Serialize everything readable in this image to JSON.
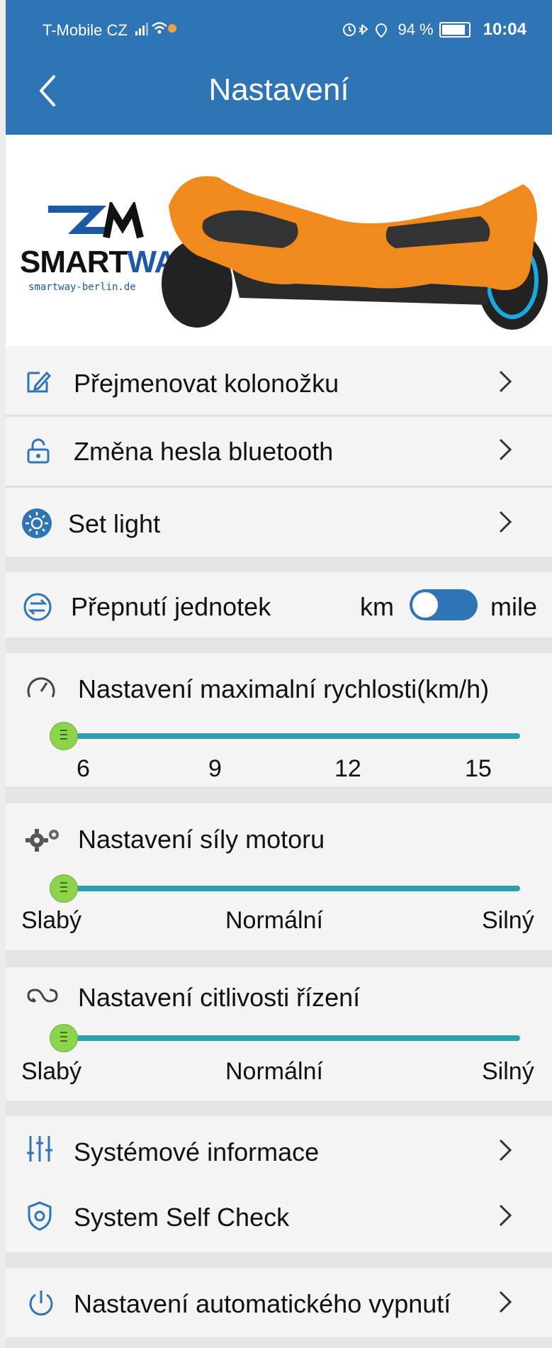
{
  "status": {
    "carrier": "T-Mobile CZ",
    "battery": "94 %",
    "time": "10:04"
  },
  "header": {
    "title": "Nastavení"
  },
  "hero": {
    "brand_a": "SMART",
    "brand_b": "WAY",
    "url": "smartway-berlin.de"
  },
  "menu": {
    "rename": "Přejmenovat kolonožku",
    "password": "Změna hesla bluetooth",
    "light": "Set light"
  },
  "units": {
    "label": "Přepnutí jednotek",
    "left": "km",
    "right": "mile",
    "selected": "km"
  },
  "speed": {
    "label": "Nastavení maximalní rychlosti(km/h)",
    "ticks": [
      "6",
      "9",
      "12",
      "15"
    ],
    "value": 6
  },
  "motor": {
    "label": "Nastavení síly motoru",
    "ticks": [
      "Slabý",
      "Normální",
      "Silný"
    ],
    "value": "Slabý"
  },
  "steer": {
    "label": "Nastavení citlivosti řízení",
    "ticks": [
      "Slabý",
      "Normální",
      "Silný"
    ],
    "value": "Slabý"
  },
  "system": {
    "info": "Systémové informace",
    "selfcheck": "System Self Check"
  },
  "power": {
    "auto_off": "Nastavení automatického vypnutí"
  },
  "colors": {
    "accent": "#2f74b5",
    "slider": "#2aa1ad",
    "knob": "#8ed34c",
    "board": "#f08a1c"
  }
}
